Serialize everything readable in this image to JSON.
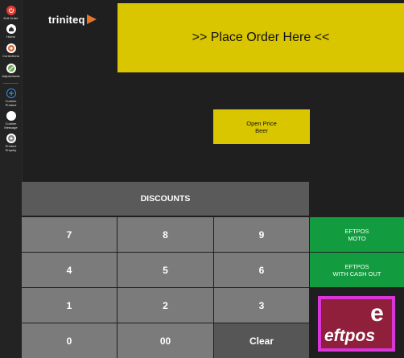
{
  "sidebar": {
    "items": [
      {
        "label": "Exit Order",
        "icon": "power-icon",
        "color": "#e03a2f"
      },
      {
        "label": "Home",
        "icon": "home-icon",
        "color": "#ffffff"
      },
      {
        "label": "Corrections",
        "icon": "corrections-icon",
        "color": "#e06a3a"
      },
      {
        "label": "Adjustments",
        "icon": "adjustments-icon",
        "color": "#ffffff"
      },
      {
        "label": "Custom Product",
        "icon": "plus-icon",
        "color": "#3a8fe0"
      },
      {
        "label": "Custom Message",
        "icon": "message-icon",
        "color": "#ffffff"
      },
      {
        "label": "Product Enquiry",
        "icon": "enquiry-icon",
        "color": "#ffffff"
      }
    ]
  },
  "logo": {
    "text": "triniteq",
    "accent": "#e8742a"
  },
  "order": {
    "place_label": ">> Place Order Here <<"
  },
  "products": [
    {
      "line1": "Open Price",
      "line2": "Beer"
    }
  ],
  "discounts": {
    "label": "DISCOUNTS"
  },
  "keypad": {
    "keys": [
      "7",
      "8",
      "9",
      "4",
      "5",
      "6",
      "1",
      "2",
      "3",
      "0",
      "00",
      "Clear"
    ]
  },
  "payments": {
    "moto": {
      "line1": "EFTPOS",
      "line2": "MOTO"
    },
    "cashout": {
      "line1": "EFTPOS",
      "line2": "WITH CASH OUT"
    },
    "eftpos_logo": {
      "letter": "e",
      "word": "eftpos"
    }
  },
  "colors": {
    "accent_yellow": "#d9c600",
    "keypad_grey": "#7b7b7b",
    "payment_green": "#139b3f",
    "eftpos_border": "#d935d9",
    "eftpos_bg": "#8f1f3b"
  }
}
